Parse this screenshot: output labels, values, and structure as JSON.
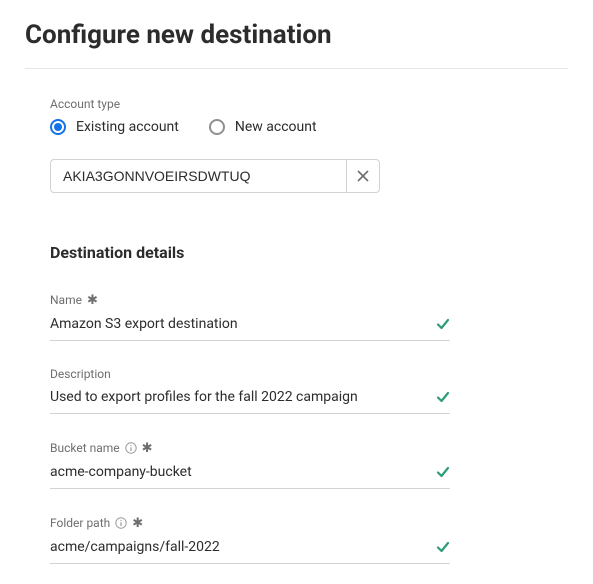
{
  "title": "Configure new destination",
  "accountType": {
    "label": "Account type",
    "options": {
      "existing": "Existing account",
      "new": "New account"
    },
    "value": "AKIA3GONNVOEIRSDWTUQ"
  },
  "details": {
    "heading": "Destination details",
    "name": {
      "label": "Name",
      "value": "Amazon S3 export destination"
    },
    "description": {
      "label": "Description",
      "value": "Used to export profiles for the fall 2022 campaign"
    },
    "bucket": {
      "label": "Bucket name",
      "value": "acme-company-bucket"
    },
    "folder": {
      "label": "Folder path",
      "value": "acme/campaigns/fall-2022"
    }
  }
}
